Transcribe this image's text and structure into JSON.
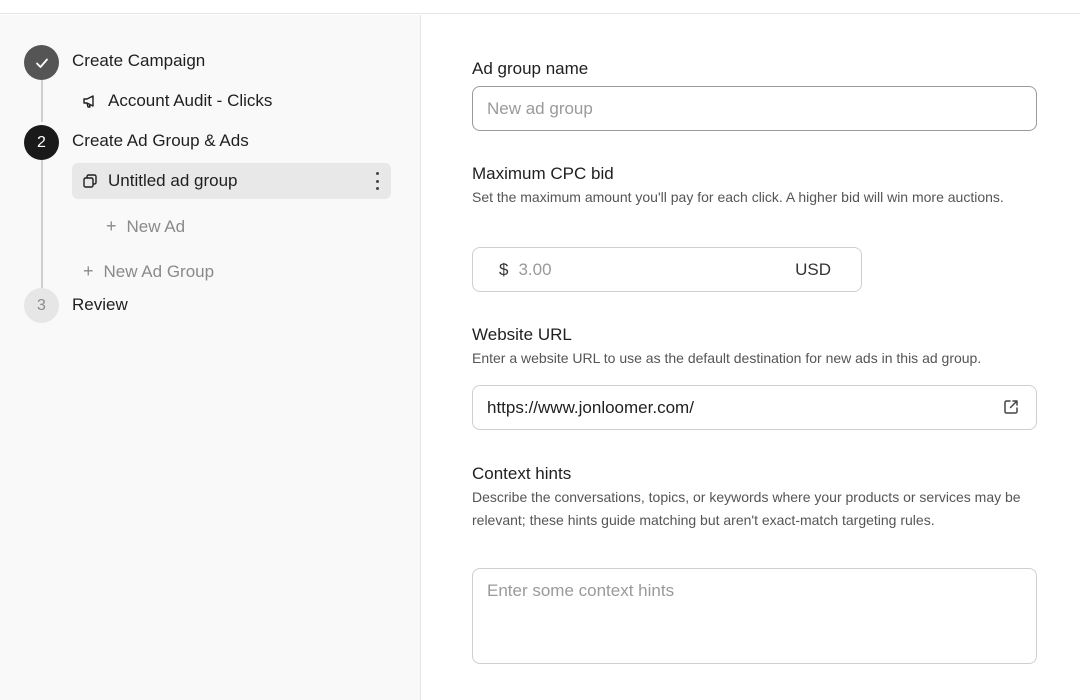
{
  "steps": [
    {
      "number": "✓",
      "title": "Create Campaign",
      "state": "done"
    },
    {
      "number": "2",
      "title": "Create Ad Group & Ads",
      "state": "active"
    },
    {
      "number": "3",
      "title": "Review",
      "state": "pending"
    }
  ],
  "campaign": {
    "name": "Account Audit - Clicks",
    "icon": "megaphone-icon"
  },
  "ad_group": {
    "name": "Untitled ad group",
    "icon": "copy-stack-icon",
    "menu_icon": "more-vertical-icon"
  },
  "actions": {
    "new_ad": "New Ad",
    "new_ad_group": "New Ad Group",
    "plus": "+"
  },
  "form": {
    "ad_group_name": {
      "label": "Ad group name",
      "placeholder": "New ad group",
      "value": ""
    },
    "max_cpc": {
      "label": "Maximum CPC bid",
      "help": "Set the maximum amount you'll pay for each click. A higher bid will win more auctions.",
      "currency_symbol": "$",
      "placeholder": "3.00",
      "currency": "USD"
    },
    "website_url": {
      "label": "Website URL",
      "help": "Enter a website URL to use as the default destination for new ads in this ad group.",
      "value": "https://www.jonloomer.com/",
      "icon": "external-link-icon"
    },
    "context_hints": {
      "label": "Context hints",
      "help": "Describe the conversations, topics, or keywords where your products or services may be relevant; these hints guide matching but aren't exact-match targeting rules.",
      "placeholder": "Enter some context hints"
    }
  },
  "colors": {
    "active_step": "#1a1a1a",
    "done_step": "#555555",
    "pending_step": "#e6e6e6",
    "selected_bg": "#e8e8e8"
  }
}
